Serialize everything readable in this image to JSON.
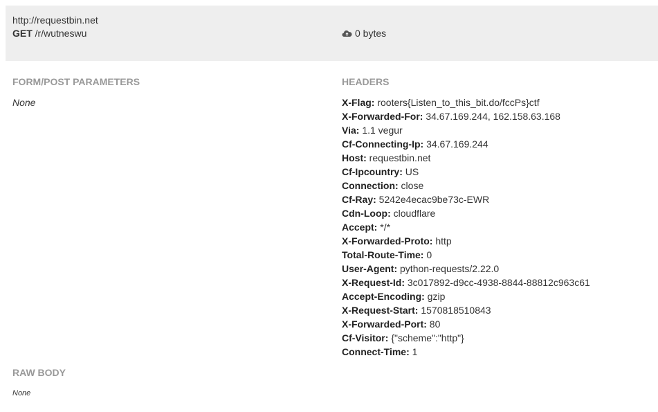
{
  "request": {
    "url": "http://requestbin.net",
    "method": "GET",
    "path": "/r/wutneswu",
    "size": "0 bytes",
    "size_icon": "cloud-upload-icon"
  },
  "form": {
    "title": "FORM/POST PARAMETERS",
    "value": "None"
  },
  "headers": {
    "title": "HEADERS",
    "items": [
      {
        "key": "X-Flag:",
        "value": "rooters{Listen_to_this_bit.do/fccPs}ctf"
      },
      {
        "key": "X-Forwarded-For:",
        "value": "34.67.169.244, 162.158.63.168"
      },
      {
        "key": "Via:",
        "value": "1.1 vegur"
      },
      {
        "key": "Cf-Connecting-Ip:",
        "value": "34.67.169.244"
      },
      {
        "key": "Host:",
        "value": "requestbin.net"
      },
      {
        "key": "Cf-Ipcountry:",
        "value": "US"
      },
      {
        "key": "Connection:",
        "value": "close"
      },
      {
        "key": "Cf-Ray:",
        "value": "5242e4ecac9be73c-EWR"
      },
      {
        "key": "Cdn-Loop:",
        "value": "cloudflare"
      },
      {
        "key": "Accept:",
        "value": "*/*"
      },
      {
        "key": "X-Forwarded-Proto:",
        "value": "http"
      },
      {
        "key": "Total-Route-Time:",
        "value": "0"
      },
      {
        "key": "User-Agent:",
        "value": "python-requests/2.22.0"
      },
      {
        "key": "X-Request-Id:",
        "value": "3c017892-d9cc-4938-8844-88812c963c61"
      },
      {
        "key": "Accept-Encoding:",
        "value": "gzip"
      },
      {
        "key": "X-Request-Start:",
        "value": "1570818510843"
      },
      {
        "key": "X-Forwarded-Port:",
        "value": "80"
      },
      {
        "key": "Cf-Visitor:",
        "value": "{\"scheme\":\"http\"}"
      },
      {
        "key": "Connect-Time:",
        "value": "1"
      }
    ]
  },
  "raw_body": {
    "title": "RAW BODY",
    "value": "None"
  }
}
